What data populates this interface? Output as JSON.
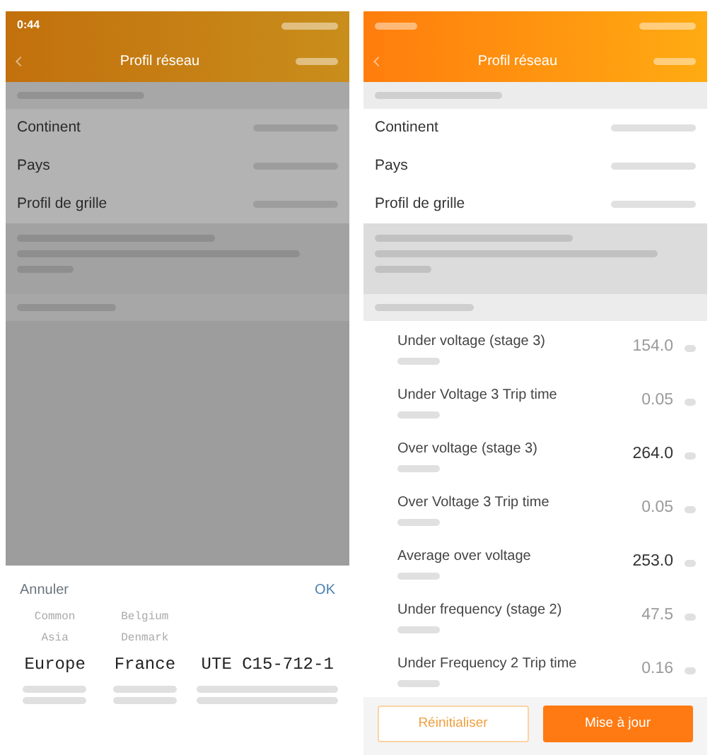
{
  "screens": [
    {
      "dimmed": true,
      "status_time": "0:44",
      "title": "Profil réseau",
      "fields": [
        {
          "label": "Continent"
        },
        {
          "label": "Pays"
        },
        {
          "label": "Profil de grille"
        }
      ],
      "picker": {
        "cancel": "Annuler",
        "confirm": "OK",
        "columns": [
          {
            "items": [
              {
                "label": "Common",
                "selected": false
              },
              {
                "label": "Asia",
                "selected": false
              },
              {
                "label": "Europe",
                "selected": true
              }
            ]
          },
          {
            "items": [
              {
                "label": "Belgium",
                "selected": false
              },
              {
                "label": "Denmark",
                "selected": false
              },
              {
                "label": "France",
                "selected": true
              }
            ]
          },
          {
            "items": [
              {
                "label": "UTE C15-712-1",
                "selected": true
              }
            ]
          }
        ]
      }
    },
    {
      "dimmed": false,
      "title": "Profil réseau",
      "fields": [
        {
          "label": "Continent"
        },
        {
          "label": "Pays"
        },
        {
          "label": "Profil de grille"
        }
      ],
      "parameters": [
        {
          "label": "Under voltage (stage 3)",
          "value": "154.0",
          "emphasized": false
        },
        {
          "label": "Under Voltage 3 Trip time",
          "value": "0.05",
          "emphasized": false
        },
        {
          "label": "Over voltage (stage 3)",
          "value": "264.0",
          "emphasized": true
        },
        {
          "label": "Over Voltage 3 Trip time",
          "value": "0.05",
          "emphasized": false
        },
        {
          "label": "Average over voltage",
          "value": "253.0",
          "emphasized": true
        },
        {
          "label": "Under frequency (stage 2)",
          "value": "47.5",
          "emphasized": false
        },
        {
          "label": "Under Frequency 2 Trip time",
          "value": "0.16",
          "emphasized": false
        }
      ],
      "buttons": [
        {
          "label": "Réinitialiser",
          "kind": "outline"
        },
        {
          "label": "Mise à jour",
          "kind": "primary"
        }
      ]
    }
  ]
}
